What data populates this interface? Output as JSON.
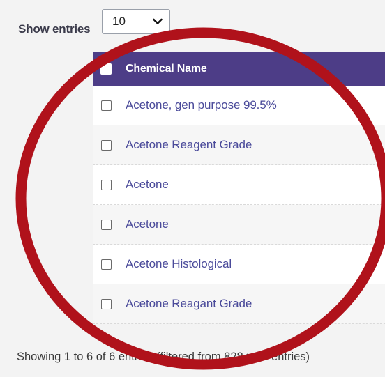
{
  "length_menu": {
    "label": "Show entries",
    "selected": "10"
  },
  "table": {
    "header": {
      "column": "Chemical Name"
    },
    "rows": [
      {
        "name": "Acetone, gen purpose 99.5%"
      },
      {
        "name": "Acetone Reagent Grade"
      },
      {
        "name": "Acetone"
      },
      {
        "name": "Acetone"
      },
      {
        "name": "Acetone Histological"
      },
      {
        "name": "Acetone Reagant Grade"
      }
    ]
  },
  "info": {
    "text": "Showing 1 to 6 of 6 entries (filtered from 828 total entries)"
  },
  "colors": {
    "header_bg": "#4d3d87",
    "link": "#4a4a9a",
    "annotation": "#b0121b"
  }
}
